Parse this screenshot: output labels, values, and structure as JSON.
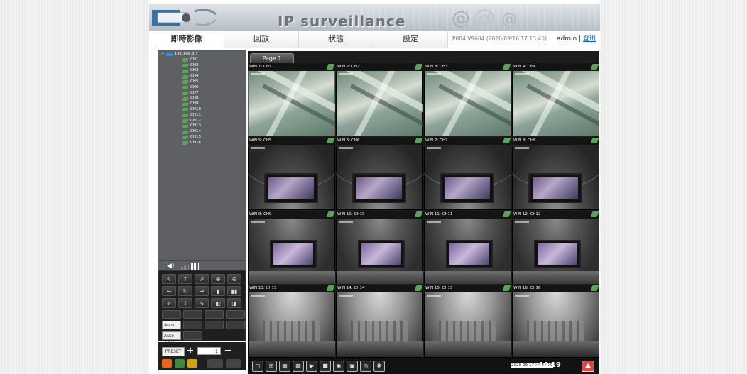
{
  "header": {
    "brand": "IP surveillance"
  },
  "tabs": [
    {
      "label": "即時影像",
      "active": true
    },
    {
      "label": "回放",
      "active": false
    },
    {
      "label": "狀態",
      "active": false
    },
    {
      "label": "設定",
      "active": false
    }
  ],
  "version_info": "P804 V9604 (2020/09/16 17:13:45)",
  "user": {
    "name": "admin",
    "separator": "|",
    "logout": "登出"
  },
  "device_tree": {
    "root": "192.168.3.1",
    "channels": [
      "CH1",
      "CH2",
      "CH3",
      "CH4",
      "CH5",
      "CH6",
      "CH7",
      "CH8",
      "CH9",
      "CH10",
      "CH11",
      "CH12",
      "CH13",
      "CH14",
      "CH15",
      "CH16"
    ]
  },
  "ptz": {
    "auto_pan": "Auto Pan",
    "auto_scan": "Auto SCAN",
    "preset_label": "PRESET",
    "preset_value": "1"
  },
  "view": {
    "page_label": "Page 1",
    "windows": [
      "WIN 1: CH1",
      "WIN 2: CH2",
      "WIN 3: CH3",
      "WIN 4: CH4",
      "WIN 5: CH5",
      "WIN 6: CH6",
      "WIN 7: CH7",
      "WIN 8: CH8",
      "WIN 9: CH9",
      "WIN 10: CH10",
      "WIN 11: CH11",
      "WIN 12: CH12",
      "WIN 13: CH13",
      "WIN 14: CH14",
      "WIN 15: CH15",
      "WIN 16: CH16"
    ],
    "selected_window": 1
  },
  "clock": {
    "date_time": "2020-09-17 14:44:19",
    "time_large": ":44:19"
  }
}
